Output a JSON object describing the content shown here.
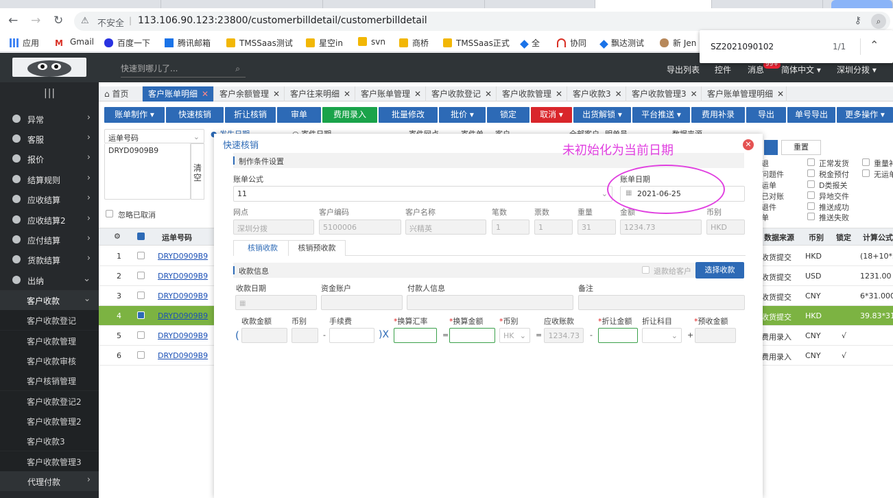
{
  "browser": {
    "security_label": "不安全",
    "url": "113.106.90.123:23800/customerbilldetail/customerbilldetail",
    "bookmarks": [
      "应用",
      "Gmail",
      "百度一下",
      "腾讯邮箱",
      "TMSSaas测试",
      "星空in",
      "svn",
      "商桥",
      "TMSSaas正式",
      "全",
      "协同",
      "飘达测试",
      "新 Jen"
    ],
    "find": {
      "query": "SZ2021090102",
      "count": "1/1"
    }
  },
  "header": {
    "quick_placeholder": "快速到哪儿了...",
    "menu": [
      "导出列表",
      "控件",
      "消息",
      "简体中文 ▾",
      "深圳分拨 ▾"
    ],
    "badge": "99+"
  },
  "sidebar": {
    "items": [
      {
        "label": "异常"
      },
      {
        "label": "客服"
      },
      {
        "label": "报价"
      },
      {
        "label": "结算规则"
      },
      {
        "label": "应收结算"
      },
      {
        "label": "应收结算2"
      },
      {
        "label": "应付结算"
      },
      {
        "label": "货款结算"
      },
      {
        "label": "出纳"
      }
    ],
    "open_group": "客户收款",
    "sub_items": [
      "客户收款登记",
      "客户收款管理",
      "客户收款审核",
      "客户核销管理",
      "客户收款登记2",
      "客户收款管理2",
      "客户收款3",
      "客户收款管理3"
    ],
    "last_item": "代理付款"
  },
  "tabs": [
    "首页",
    "客户账单明细",
    "客户余额管理",
    "客户往来明细",
    "客户账单管理",
    "客户收款登记",
    "客户收款管理",
    "客户收款3",
    "客户收款管理3",
    "客户账单管理明细"
  ],
  "toolbar": [
    "账单制作 ▾",
    "快速核销",
    "折让核销",
    "审单",
    "费用录入",
    "批量修改",
    "批价 ▾",
    "锁定",
    "取消 ▾",
    "出货解锁 ▾",
    "平台推送 ▾",
    "费用补录",
    "导出",
    "单号导出",
    "更多操作 ▾"
  ],
  "filters": {
    "field_select": "运单号码",
    "field_value": "DRYD0909B9",
    "clear_label": "清空",
    "ignore_cancel": "忽略已取消",
    "row_labels": [
      "发生日期",
      "寄件日期",
      "寄件网点",
      "寄件单",
      "客户",
      "全部客户",
      "明单员",
      "数据来源"
    ],
    "reset_btn": "重置",
    "checks": [
      "退",
      "正常发货",
      "重量补",
      "问题件",
      "税金预付",
      "无运单",
      "运单",
      "D类报关",
      "已对账",
      "异地交件",
      "退件",
      "推送成功",
      "单",
      "推送失败"
    ]
  },
  "table": {
    "headers": [
      "运单号码",
      "数据来源",
      "币别",
      "锁定",
      "计算公式"
    ],
    "rows": [
      {
        "no": "1",
        "waybill": "DRYD0909B9",
        "source": "收货提交",
        "currency": "HKD",
        "lock": "",
        "formula": "(18+10*3"
      },
      {
        "no": "2",
        "waybill": "DRYD0909B9",
        "source": "收货提交",
        "currency": "USD",
        "lock": "",
        "formula": "1231.00"
      },
      {
        "no": "3",
        "waybill": "DRYD0909B9",
        "source": "收货提交",
        "currency": "CNY",
        "lock": "",
        "formula": "6*31.000"
      },
      {
        "no": "4",
        "waybill": "DRYD0909B9",
        "source": "收货提交",
        "currency": "HKD",
        "lock": "",
        "formula": "39.83*31"
      },
      {
        "no": "5",
        "waybill": "DRYD0909B9",
        "source": "费用录入",
        "currency": "CNY",
        "lock": "√",
        "formula": ""
      },
      {
        "no": "6",
        "waybill": "DRYD0909B9",
        "source": "费用录入",
        "currency": "CNY",
        "lock": "√",
        "formula": ""
      }
    ]
  },
  "modal": {
    "title": "快速核销",
    "section1": "制作条件设置",
    "bill_formula_label": "账单公式",
    "bill_formula_value": "11",
    "bill_date_label": "账单日期",
    "bill_date_value": "2021-06-25",
    "info_labels": [
      "网点",
      "客户编码",
      "客户名称",
      "笔数",
      "票数",
      "重量",
      "金额",
      "币别"
    ],
    "info_values": [
      "深圳分拨",
      "5100006",
      "兴精英",
      "1",
      "1",
      "31",
      "1234.73",
      "HKD"
    ],
    "tabs": [
      "核销收款",
      "核销预收款"
    ],
    "section2": "收款信息",
    "refund_label": "退款给客户",
    "select_btn": "选择收款",
    "recv_labels": [
      "收款日期",
      "资金账户",
      "付款人信息",
      "备注"
    ],
    "calc_labels": [
      "收款金额",
      "币别",
      "手续费",
      "换算汇率",
      "换算金额",
      "币别",
      "应收账款",
      "折让金额",
      "折让科目",
      "预收金额"
    ],
    "calc_currency": "HK",
    "receivable": "1234.73",
    "symbols": [
      "(",
      "-",
      ")X",
      "=",
      "=",
      "-",
      "+"
    ]
  },
  "annotation": "未初始化为当前日期"
}
